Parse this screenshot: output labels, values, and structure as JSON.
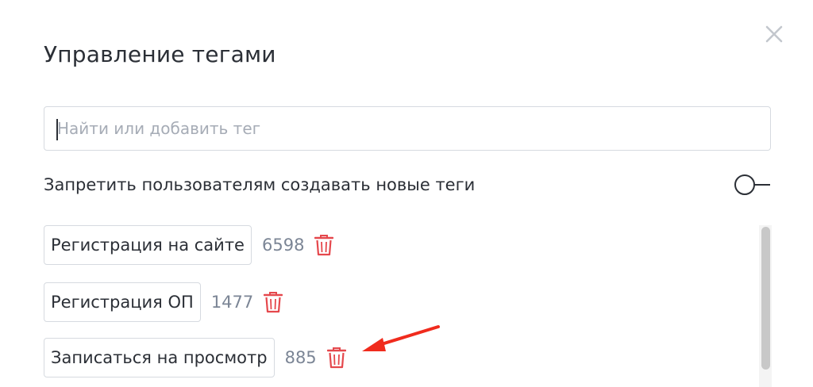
{
  "dialog": {
    "title": "Управление тегами",
    "close_icon": "close-icon"
  },
  "search": {
    "placeholder": "Найти или добавить тег",
    "value": ""
  },
  "setting": {
    "label": "Запретить пользователям создавать новые теги",
    "enabled": false
  },
  "tags": [
    {
      "label": "Регистрация на сайте",
      "count": "6598",
      "icon": "trash-icon"
    },
    {
      "label": "Регистрация ОП",
      "count": "1477",
      "icon": "trash-icon"
    },
    {
      "label": "Записаться на просмотр",
      "count": "885",
      "icon": "trash-icon"
    }
  ],
  "colors": {
    "trash": "#e5484d",
    "arrow": "#f02b1d",
    "muted_text": "#7b8595"
  }
}
